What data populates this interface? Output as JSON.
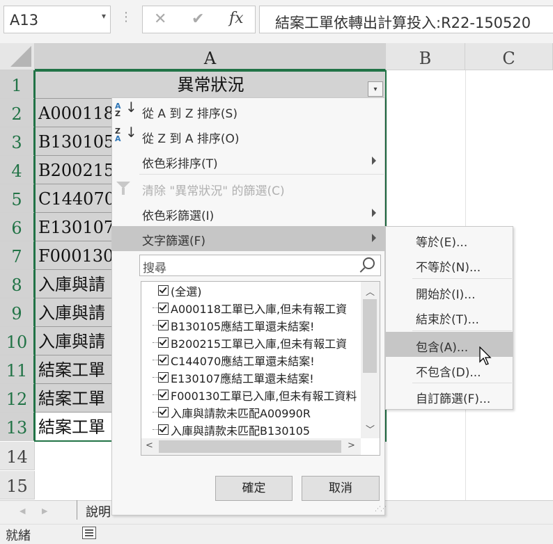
{
  "formula_bar": {
    "name_box": "A13",
    "cancel_glyph": "✕",
    "enter_glyph": "✔",
    "fx_label": "fx",
    "formula": "結案工單依轉出計算投入:R22-150520"
  },
  "columns": [
    "A",
    "B",
    "C"
  ],
  "rows": [
    "1",
    "2",
    "3",
    "4",
    "5",
    "6",
    "7",
    "8",
    "9",
    "10",
    "11",
    "12",
    "13",
    "14",
    "15"
  ],
  "cells": {
    "header": "異常狀況",
    "values": [
      "A000118",
      "B130105/",
      "B200215.",
      "C144070/",
      "E130107/",
      "F000130.",
      "入庫與請",
      "入庫與請",
      "入庫與請",
      "結案工單",
      "結案工單",
      "結案工單"
    ]
  },
  "filter_menu": {
    "sort_az": "從 A 到 Z 排序(S)",
    "sort_za": "從 Z 到 A 排序(O)",
    "sort_color": "依色彩排序(T)",
    "clear_filter": "清除 \"異常狀況\" 的篩選(C)",
    "filter_color": "依色彩篩選(I)",
    "text_filter": "文字篩選(F)",
    "search_placeholder": "搜尋",
    "items": [
      "(全選)",
      "A000118工單已入庫,但未有報工資",
      "B130105應結工單還未結案!",
      "B200215工單已入庫,但未有報工資",
      "C144070應結工單還未結案!",
      "E130107應結工單還未結案!",
      "F000130工單已入庫,但未有報工資料",
      "入庫與請款未匹配A00990R",
      "入庫與請款未匹配B130105"
    ],
    "ok": "確定",
    "cancel": "取消"
  },
  "text_filter_submenu": {
    "equals": "等於(E)...",
    "not_equals": "不等於(N)...",
    "begins_with": "開始於(I)...",
    "ends_with": "結束於(T)...",
    "contains": "包含(A)...",
    "not_contains": "不包含(D)...",
    "custom": "自訂篩選(F)..."
  },
  "sheet_tabs": {
    "tab1": "說明"
  },
  "status_bar": {
    "ready": "就緒"
  },
  "colors": {
    "accent": "#217346",
    "highlight": "#c6c6c6",
    "az_blue": "#2e75b6"
  }
}
